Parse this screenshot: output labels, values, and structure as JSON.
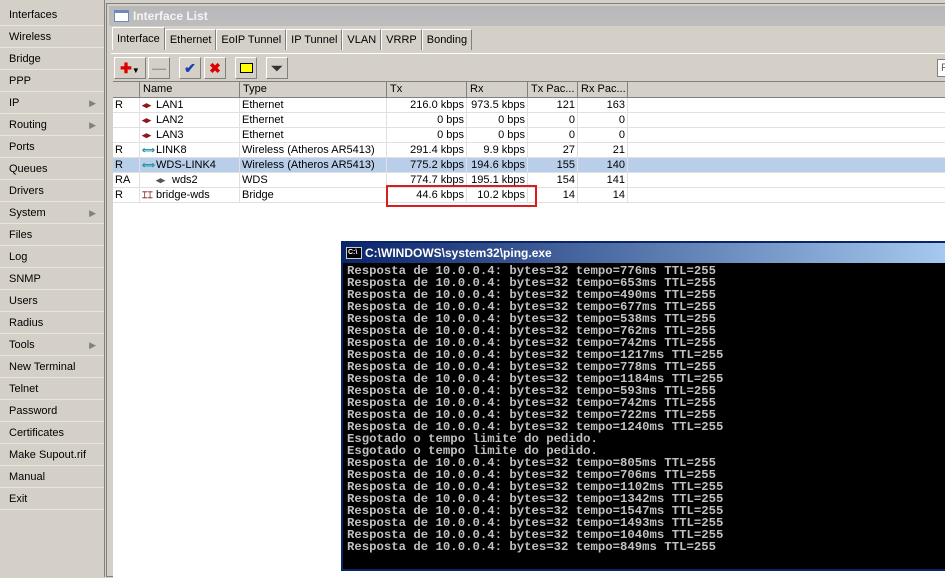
{
  "sidebar": {
    "items": [
      {
        "label": "Interfaces",
        "sub": false
      },
      {
        "label": "Wireless",
        "sub": false
      },
      {
        "label": "Bridge",
        "sub": false
      },
      {
        "label": "PPP",
        "sub": false
      },
      {
        "label": "IP",
        "sub": true
      },
      {
        "label": "Routing",
        "sub": true
      },
      {
        "label": "Ports",
        "sub": false
      },
      {
        "label": "Queues",
        "sub": false
      },
      {
        "label": "Drivers",
        "sub": false
      },
      {
        "label": "System",
        "sub": true
      },
      {
        "label": "Files",
        "sub": false
      },
      {
        "label": "Log",
        "sub": false
      },
      {
        "label": "SNMP",
        "sub": false
      },
      {
        "label": "Users",
        "sub": false
      },
      {
        "label": "Radius",
        "sub": false
      },
      {
        "label": "Tools",
        "sub": true
      },
      {
        "label": "New Terminal",
        "sub": false
      },
      {
        "label": "Telnet",
        "sub": false
      },
      {
        "label": "Password",
        "sub": false
      },
      {
        "label": "Certificates",
        "sub": false
      },
      {
        "label": "Make Supout.rif",
        "sub": false
      },
      {
        "label": "Manual",
        "sub": false
      },
      {
        "label": "Exit",
        "sub": false
      }
    ]
  },
  "window": {
    "title": "Interface List",
    "tabs": [
      "Interface",
      "Ethernet",
      "EoIP Tunnel",
      "IP Tunnel",
      "VLAN",
      "VRRP",
      "Bonding"
    ],
    "find_placeholder": "F",
    "columns": [
      "",
      "Name",
      "Type",
      "Tx",
      "Rx",
      "Tx Pac...",
      "Rx Pac..."
    ],
    "rows": [
      {
        "flags": "R",
        "name": "LAN1",
        "icon": "ethernet-icon",
        "type": "Ethernet",
        "tx": "216.0 kbps",
        "rx": "973.5 kbps",
        "txp": "121",
        "rxp": "163"
      },
      {
        "flags": "",
        "name": "LAN2",
        "icon": "ethernet-icon",
        "type": "Ethernet",
        "tx": "0 bps",
        "rx": "0 bps",
        "txp": "0",
        "rxp": "0"
      },
      {
        "flags": "",
        "name": "LAN3",
        "icon": "ethernet-icon",
        "type": "Ethernet",
        "tx": "0 bps",
        "rx": "0 bps",
        "txp": "0",
        "rxp": "0"
      },
      {
        "flags": "R",
        "name": "LINK8",
        "icon": "wireless-icon",
        "type": "Wireless (Atheros AR5413)",
        "tx": "291.4 kbps",
        "rx": "9.9 kbps",
        "txp": "27",
        "rxp": "21"
      },
      {
        "flags": "R",
        "name": "WDS-LINK4",
        "icon": "wireless-icon",
        "type": "Wireless (Atheros AR5413)",
        "tx": "775.2 kbps",
        "rx": "194.6 kbps",
        "txp": "155",
        "rxp": "140",
        "selected": true
      },
      {
        "flags": "RA",
        "name": "wds2",
        "icon": "wds-icon",
        "type": "WDS",
        "tx": "774.7 kbps",
        "rx": "195.1 kbps",
        "txp": "154",
        "rxp": "141"
      },
      {
        "flags": "R",
        "name": "bridge-wds",
        "icon": "bridge-icon",
        "type": "Bridge",
        "tx": "44.6 kbps",
        "rx": "10.2 kbps",
        "txp": "14",
        "rxp": "14"
      }
    ]
  },
  "console": {
    "title": "C:\\WINDOWS\\system32\\ping.exe",
    "lines": [
      "Resposta de 10.0.0.4: bytes=32 tempo=776ms TTL=255",
      "Resposta de 10.0.0.4: bytes=32 tempo=653ms TTL=255",
      "Resposta de 10.0.0.4: bytes=32 tempo=490ms TTL=255",
      "Resposta de 10.0.0.4: bytes=32 tempo=677ms TTL=255",
      "Resposta de 10.0.0.4: bytes=32 tempo=538ms TTL=255",
      "Resposta de 10.0.0.4: bytes=32 tempo=762ms TTL=255",
      "Resposta de 10.0.0.4: bytes=32 tempo=742ms TTL=255",
      "Resposta de 10.0.0.4: bytes=32 tempo=1217ms TTL=255",
      "Resposta de 10.0.0.4: bytes=32 tempo=778ms TTL=255",
      "Resposta de 10.0.0.4: bytes=32 tempo=1184ms TTL=255",
      "Resposta de 10.0.0.4: bytes=32 tempo=593ms TTL=255",
      "Resposta de 10.0.0.4: bytes=32 tempo=742ms TTL=255",
      "Resposta de 10.0.0.4: bytes=32 tempo=722ms TTL=255",
      "Resposta de 10.0.0.4: bytes=32 tempo=1240ms TTL=255",
      "Esgotado o tempo limite do pedido.",
      "Esgotado o tempo limite do pedido.",
      "Resposta de 10.0.0.4: bytes=32 tempo=805ms TTL=255",
      "Resposta de 10.0.0.4: bytes=32 tempo=706ms TTL=255",
      "Resposta de 10.0.0.4: bytes=32 tempo=1102ms TTL=255",
      "Resposta de 10.0.0.4: bytes=32 tempo=1342ms TTL=255",
      "Resposta de 10.0.0.4: bytes=32 tempo=1547ms TTL=255",
      "Resposta de 10.0.0.4: bytes=32 tempo=1493ms TTL=255",
      "Resposta de 10.0.0.4: bytes=32 tempo=1040ms TTL=255",
      "Resposta de 10.0.0.4: bytes=32 tempo=849ms TTL=255"
    ]
  }
}
